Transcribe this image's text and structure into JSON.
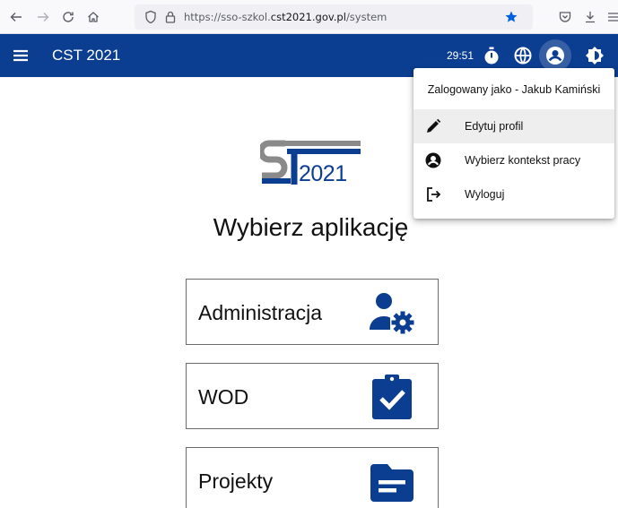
{
  "browser": {
    "url_prefix": "https://sso-szkol.",
    "url_domain": "cst2021.gov.pl",
    "url_suffix": "/system"
  },
  "app_bar": {
    "title": "CST 2021",
    "timer": "29:51"
  },
  "logo": {
    "year": "2021"
  },
  "main": {
    "heading": "Wybierz aplikację",
    "cards": [
      {
        "label": "Administracja",
        "icon": "admin-settings-icon"
      },
      {
        "label": "WOD",
        "icon": "clipboard-check-icon"
      },
      {
        "label": "Projekty",
        "icon": "folder-icon"
      }
    ]
  },
  "user_menu": {
    "header": "Zalogowany jako - Jakub Kamiński",
    "items": [
      {
        "label": "Edytuj profil",
        "icon": "pencil-icon"
      },
      {
        "label": "Wybierz kontekst pracy",
        "icon": "account-circle-icon"
      },
      {
        "label": "Wyloguj",
        "icon": "logout-icon"
      }
    ]
  },
  "colors": {
    "brand": "#0b3d91",
    "logo_gray": "#8a8a8a"
  }
}
